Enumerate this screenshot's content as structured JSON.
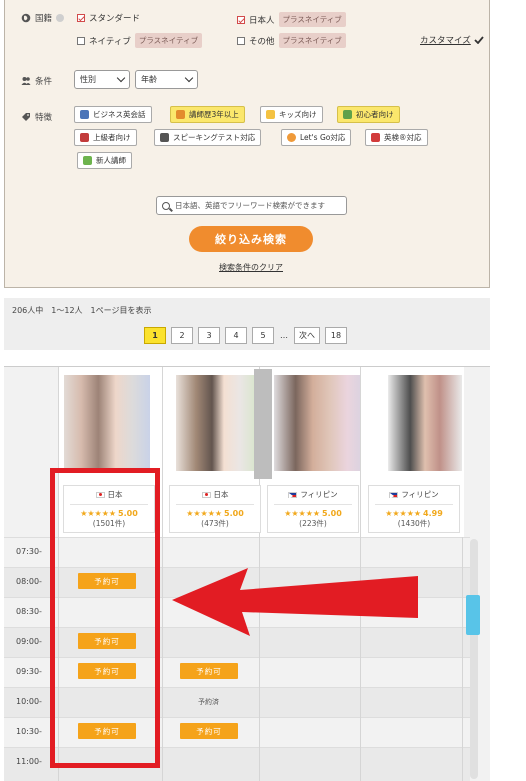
{
  "filters": {
    "nationality": {
      "label": "国籍",
      "options": [
        {
          "label": "スタンダード",
          "checked": true
        },
        {
          "label": "日本人",
          "checked": true,
          "tag": "プラスネイティブ"
        },
        {
          "label": "ネイティブ",
          "checked": false,
          "tag": "プラスネイティブ"
        },
        {
          "label": "その他",
          "checked": false,
          "tag": "プラスネイティブ"
        }
      ],
      "customize": "カスタマイズ"
    },
    "conditions": {
      "label": "条件",
      "selects": [
        "性別",
        "年齢"
      ]
    },
    "features": {
      "label": "特徴",
      "tags": [
        {
          "label": "ビジネス英会話",
          "highlight": false
        },
        {
          "label": "講師歴3年以上",
          "highlight": true
        },
        {
          "label": "キッズ向け",
          "highlight": false
        },
        {
          "label": "初心者向け",
          "highlight": true
        },
        {
          "label": "上級者向け",
          "highlight": false
        },
        {
          "label": "スピーキングテスト対応",
          "highlight": false
        },
        {
          "label": "Let's Go対応",
          "highlight": false
        },
        {
          "label": "英検®対応",
          "highlight": false
        },
        {
          "label": "新人講師",
          "highlight": false
        }
      ]
    },
    "search": {
      "placeholder": "日本語、英語でフリーワード検索ができます"
    },
    "submit": "絞り込み検索",
    "clear": "検索条件のクリア"
  },
  "results": {
    "summary": "206人中　1～12人　1ページ目を表示",
    "pages": [
      "1",
      "2",
      "3",
      "4",
      "5",
      "…",
      "次へ",
      "18"
    ]
  },
  "teachers": [
    {
      "country": "日本",
      "flag": "jp",
      "stars": "★★★★★",
      "score": "5.00",
      "reviews": "(1501件)"
    },
    {
      "country": "日本",
      "flag": "jp",
      "stars": "★★★★★",
      "score": "5.00",
      "reviews": "(473件)"
    },
    {
      "country": "フィリピン",
      "flag": "ph",
      "stars": "★★★★★",
      "score": "5.00",
      "reviews": "(223件)"
    },
    {
      "country": "フィリピン",
      "flag": "ph",
      "stars": "★★★★★",
      "score": "4.99",
      "reviews": "(1430件)"
    }
  ],
  "times": [
    "07:30-",
    "08:00-",
    "08:30-",
    "09:00-",
    "09:30-",
    "10:00-",
    "10:30-",
    "11:00-"
  ],
  "slot_labels": {
    "available": "予約可",
    "booked": "予約済"
  },
  "colors": {
    "accent": "#f08c2e",
    "book": "#f5a31a",
    "highlight_box": "#e21c23",
    "scroll_thumb": "#58c4e8"
  }
}
